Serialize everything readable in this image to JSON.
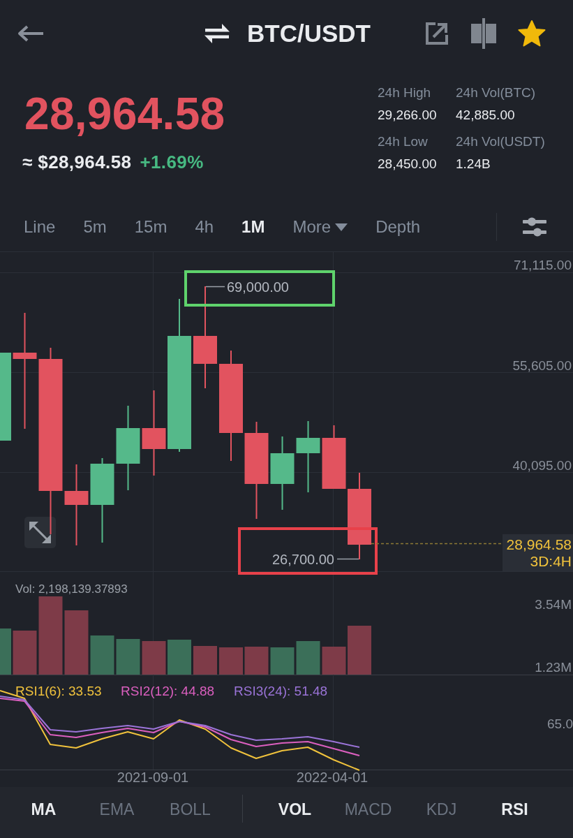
{
  "header": {
    "title": "BTC/USDT",
    "favorite": true
  },
  "price": {
    "last": "28,964.58",
    "fiat": "≈ $28,964.58",
    "change": "+1.69%"
  },
  "stats": [
    {
      "label": "24h High",
      "value": "29,266.00"
    },
    {
      "label": "24h Vol(BTC)",
      "value": "42,885.00"
    },
    {
      "label": "24h Low",
      "value": "28,450.00"
    },
    {
      "label": "24h Vol(USDT)",
      "value": "1.24B"
    }
  ],
  "intervals": [
    {
      "label": "Line",
      "kind": "tab",
      "selected": false
    },
    {
      "label": "5m",
      "kind": "tab",
      "selected": false
    },
    {
      "label": "15m",
      "kind": "tab",
      "selected": false
    },
    {
      "label": "4h",
      "kind": "tab",
      "selected": false
    },
    {
      "label": "1M",
      "kind": "tab",
      "selected": true
    },
    {
      "label": "More",
      "kind": "dropdown",
      "selected": false
    },
    {
      "label": "Depth",
      "kind": "tab",
      "selected": false
    }
  ],
  "chart": {
    "price_ticks": [
      "71,115.00",
      "55,605.00",
      "40,095.00"
    ],
    "high_marker": "69,000.00",
    "low_marker": "26,700.00",
    "last_price": "28,964.58",
    "interval_badge": "3D:4H"
  },
  "volume": {
    "label": "Vol: 2,198,139.37893",
    "ticks": [
      "3.54M",
      "1.23M"
    ]
  },
  "rsi": {
    "legend": [
      {
        "label": "RSI1(6): 33.53",
        "color": "#f0c23c"
      },
      {
        "label": "RSI2(12): 44.88",
        "color": "#db5fbf"
      },
      {
        "label": "RSI3(24): 51.48",
        "color": "#9b74d8"
      }
    ],
    "ticks": [
      "65.0"
    ]
  },
  "dates": [
    "2021-09-01",
    "2022-04-01"
  ],
  "indicators": {
    "main": [
      {
        "label": "MA",
        "selected": true
      },
      {
        "label": "EMA",
        "selected": false
      },
      {
        "label": "BOLL",
        "selected": false
      }
    ],
    "sub": [
      {
        "label": "VOL",
        "selected": true
      },
      {
        "label": "MACD",
        "selected": false
      },
      {
        "label": "KDJ",
        "selected": false
      },
      {
        "label": "RSI",
        "selected": true
      }
    ]
  }
}
